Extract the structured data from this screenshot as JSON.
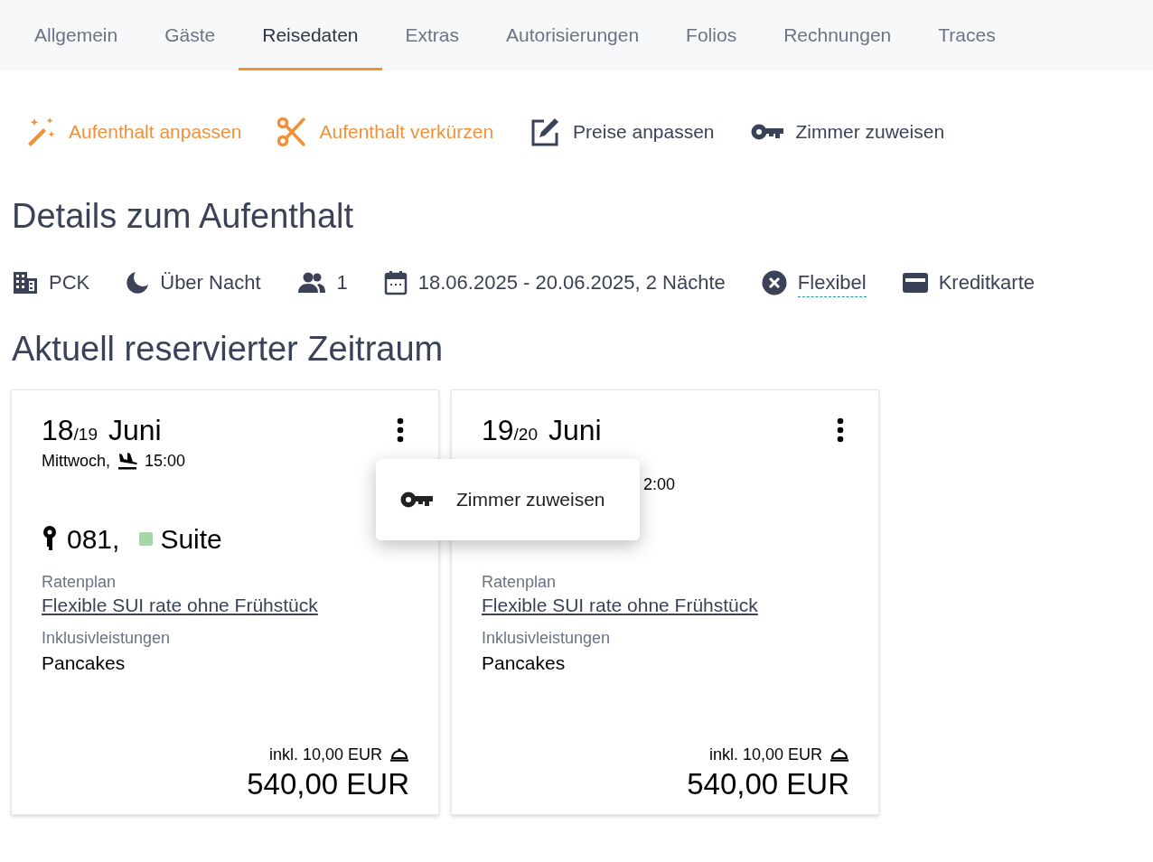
{
  "tabs": [
    {
      "label": "Allgemein",
      "selected": false
    },
    {
      "label": "Gäste",
      "selected": false
    },
    {
      "label": "Reisedaten",
      "selected": true
    },
    {
      "label": "Extras",
      "selected": false
    },
    {
      "label": "Autorisierungen",
      "selected": false
    },
    {
      "label": "Folios",
      "selected": false
    },
    {
      "label": "Rechnungen",
      "selected": false
    },
    {
      "label": "Traces",
      "selected": false
    }
  ],
  "actions": [
    {
      "kind": "wand",
      "label": "Aufenthalt anpassen",
      "highlighted": true
    },
    {
      "kind": "scissors",
      "label": "Aufenthalt verkürzen",
      "highlighted": true
    },
    {
      "kind": "edit",
      "label": "Preise anpassen",
      "highlighted": false
    },
    {
      "kind": "key",
      "label": "Zimmer zuweisen",
      "highlighted": false
    }
  ],
  "details_heading": "Details zum Aufenthalt",
  "details": [
    {
      "kind": "building",
      "text": "PCK"
    },
    {
      "kind": "moon",
      "text": "Über Nacht"
    },
    {
      "kind": "people",
      "text": "1"
    },
    {
      "kind": "calendar",
      "text": "18.06.2025 - 20.06.2025, 2 Nächte"
    },
    {
      "kind": "cancel",
      "text": "Flexibel",
      "dotted": true
    },
    {
      "kind": "card",
      "text": "Kreditkarte"
    }
  ],
  "period_heading": "Aktuell reservierter Zeitraum",
  "nights": [
    {
      "day": "18",
      "next_day": "/19",
      "month": "Juni",
      "weekday": "Mittwoch,",
      "time": "15:00",
      "room_number": "081,",
      "room_type": "Suite",
      "color": "#a5d6a7",
      "rate_label": "Ratenplan",
      "rate_plan": "Flexible SUI rate ohne Frühstück",
      "inclusive_label": "Inklusivleistungen",
      "inclusive": "Pancakes",
      "included_amount": "inkl. 10,00 EUR",
      "total": "540,00 EUR"
    },
    {
      "day": "19",
      "next_day": "/20",
      "month": "Juni",
      "time": "2:00",
      "rate_label": "Ratenplan",
      "rate_plan": "Flexible SUI rate ohne Frühstück",
      "inclusive_label": "Inklusivleistungen",
      "inclusive": "Pancakes",
      "included_amount": "inkl. 10,00 EUR",
      "total": "540,00 EUR"
    }
  ],
  "context_menu": {
    "items": [
      {
        "label": "Zimmer zuweisen"
      }
    ]
  }
}
